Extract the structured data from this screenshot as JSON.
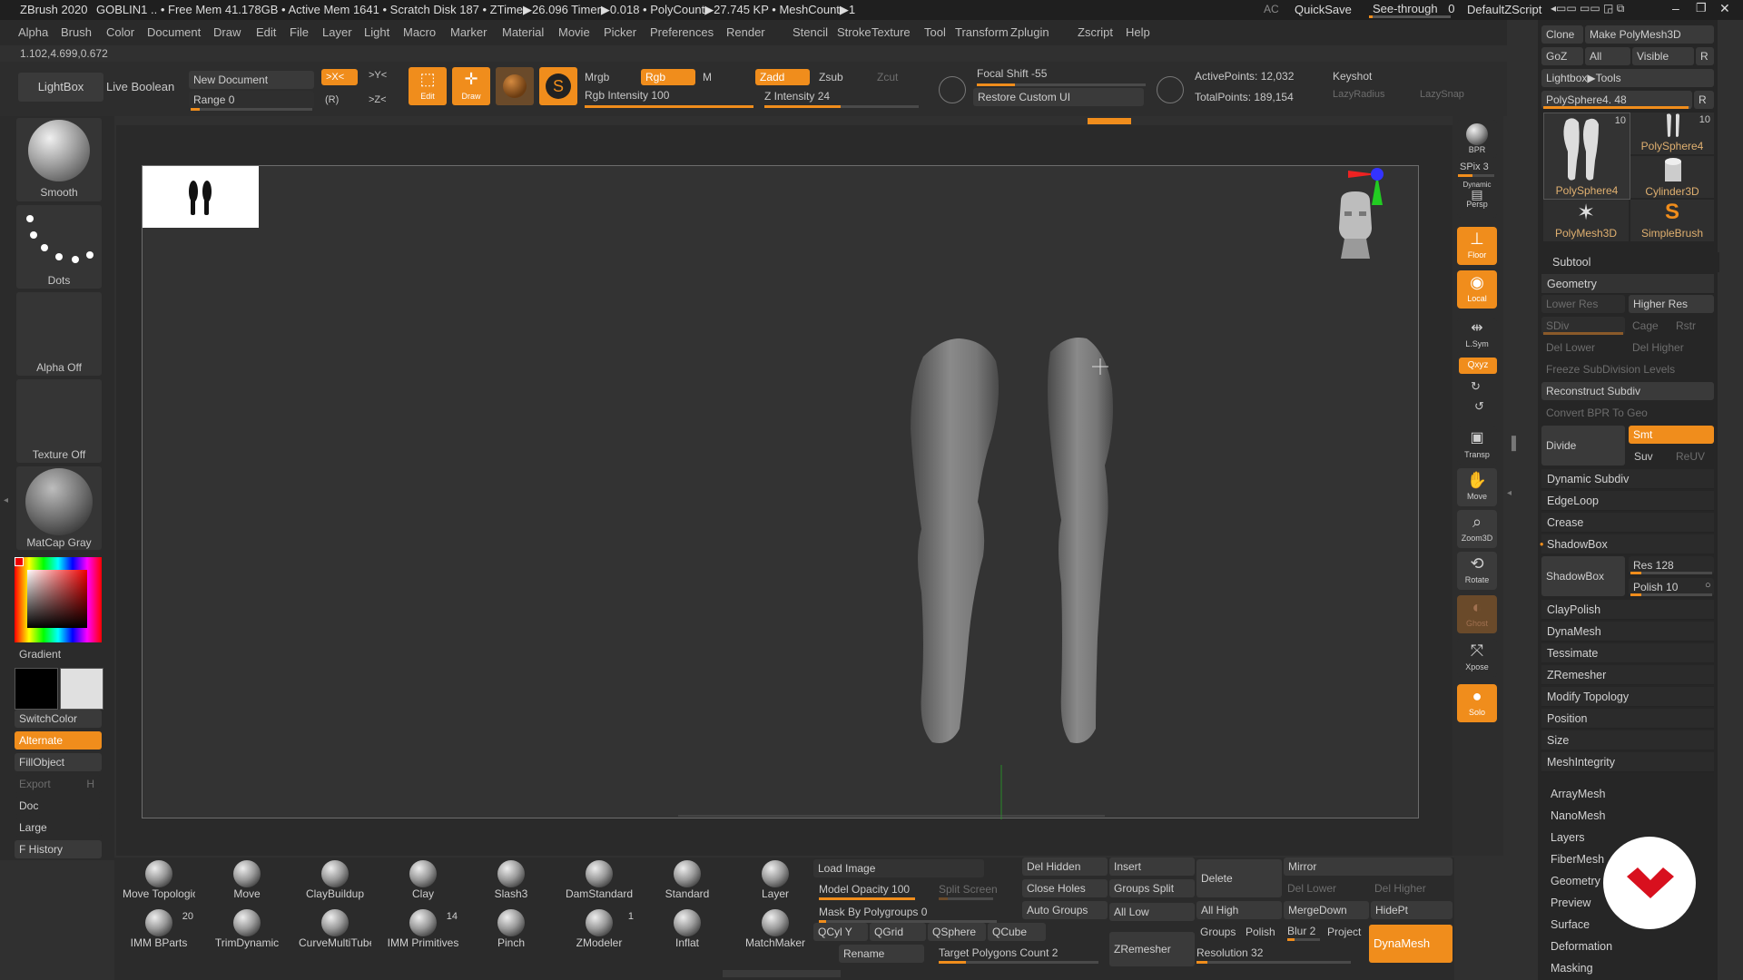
{
  "title_bar": {
    "app": "ZBrush 2020",
    "user": "GOBLIN1",
    "stats": ".. • Free Mem 41.178GB • Active Mem 1641 • Scratch Disk 187 • ZTime▶26.096 Timer▶0.018 • PolyCount▶27.745 KP • MeshCount▶1",
    "ac": "AC",
    "quicksave": "QuickSave",
    "see_through": "See-through",
    "see_through_value": "0",
    "script": "DefaultZScript"
  },
  "menu": [
    "Alpha",
    "Brush",
    "Color",
    "Document",
    "Draw",
    "Edit",
    "File",
    "Layer",
    "Light",
    "Macro",
    "Marker",
    "Material",
    "Movie",
    "Picker",
    "Preferences",
    "Render",
    "Stencil",
    "Stroke",
    "Texture",
    "Tool",
    "Transform",
    "Zplugin",
    "Zscript",
    "Help"
  ],
  "coords": "1.102,4.699,0.672",
  "top_shelf": {
    "lightbox": "LightBox",
    "live_boolean": "Live Boolean",
    "new_document": "New Document",
    "range": "Range 0",
    "sym_x": ">X<",
    "sym_y": ">Y<",
    "sym_z": ">Z<",
    "r": "(R)",
    "edit": "Edit",
    "draw": "Draw",
    "mrgb": "Mrgb",
    "rgb": "Rgb",
    "m": "M",
    "rgb_intensity": "Rgb Intensity 100",
    "zadd": "Zadd",
    "zsub": "Zsub",
    "zcut": "Zcut",
    "z_intensity": "Z Intensity 24",
    "focal_shift": "Focal Shift -55",
    "restore_ui": "Restore Custom UI",
    "active_points": "ActivePoints: 12,032",
    "total_points": "TotalPoints: 189,154",
    "keyshot": "Keyshot",
    "lazy_radius": "LazyRadius",
    "lazy_snap": "LazySnap"
  },
  "left_panel": {
    "smooth": "Smooth",
    "dots": "Dots",
    "alpha_off": "Alpha Off",
    "texture_off": "Texture Off",
    "matcap": "MatCap Gray",
    "gradient": "Gradient",
    "switch_color": "SwitchColor",
    "alternate": "Alternate",
    "fill_object": "FillObject",
    "export": "Export",
    "export_key": "H",
    "doc": "Doc",
    "large": "Large",
    "f_history": "F History"
  },
  "right_toolbar": {
    "bpr": "BPR",
    "spix": "SPix 3",
    "dynamic": "Dynamic",
    "persp": "Persp",
    "floor": "Floor",
    "local": "Local",
    "lsym": "L.Sym",
    "xyz": "Qxyz",
    "transp": "Transp",
    "move": "Move",
    "zoom3d": "Zoom3D",
    "rotate": "Rotate",
    "ghost": "Ghost",
    "xpose": "Xpose",
    "solo": "Solo"
  },
  "tool_panel": {
    "clone": "Clone",
    "make_polymesh": "Make PolyMesh3D",
    "goz": "GoZ",
    "all": "All",
    "visible": "Visible",
    "r": "R",
    "lightbox_tools": "Lightbox▶Tools",
    "polysphere_slider": "PolySphere4. 48",
    "thumbs": [
      {
        "label": "PolySphere4",
        "count": "10"
      },
      {
        "label": "PolySphere4",
        "count": "10"
      },
      {
        "label": "Cylinder3D",
        "count": ""
      },
      {
        "label": "PolyMesh3D",
        "count": ""
      },
      {
        "label": "SimpleBrush",
        "count": ""
      }
    ],
    "subtool": "Subtool",
    "geometry": "Geometry",
    "lower_res": "Lower Res",
    "higher_res": "Higher Res",
    "sdiv": "SDiv",
    "cage": "Cage",
    "rstr": "Rstr",
    "del_lower": "Del Lower",
    "del_higher": "Del Higher",
    "freeze": "Freeze SubDivision Levels",
    "reconstruct": "Reconstruct Subdiv",
    "convert_bpr": "Convert BPR To Geo",
    "divide": "Divide",
    "smt": "Smt",
    "suv": "Suv",
    "reuv": "ReUV",
    "sections": [
      "Dynamic Subdiv",
      "EdgeLoop",
      "Crease",
      "ShadowBox"
    ],
    "shadowbox": "ShadowBox",
    "res": "Res 128",
    "polish": "Polish 10",
    "more_sections": [
      "ClayPolish",
      "DynaMesh",
      "Tessimate",
      "ZRemesher",
      "Modify Topology",
      "Position",
      "Size",
      "MeshIntegrity"
    ],
    "outer_sections": [
      "ArrayMesh",
      "NanoMesh",
      "Layers",
      "FiberMesh",
      "Geometry HD",
      "Preview",
      "Surface",
      "Deformation",
      "Masking"
    ]
  },
  "bottom_brushes": [
    {
      "label": "Move Topologica",
      "count": ""
    },
    {
      "label": "Move",
      "count": ""
    },
    {
      "label": "ClayBuildup",
      "count": ""
    },
    {
      "label": "Clay",
      "count": ""
    },
    {
      "label": "Slash3",
      "count": ""
    },
    {
      "label": "DamStandard",
      "count": ""
    },
    {
      "label": "Standard",
      "count": ""
    },
    {
      "label": "Layer",
      "count": ""
    },
    {
      "label": "IMM BParts",
      "count": "20"
    },
    {
      "label": "TrimDynamic",
      "count": ""
    },
    {
      "label": "CurveMultiTube",
      "count": ""
    },
    {
      "label": "IMM Primitives",
      "count": "14"
    },
    {
      "label": "Pinch",
      "count": ""
    },
    {
      "label": "ZModeler",
      "count": "1"
    },
    {
      "label": "Inflat",
      "count": ""
    },
    {
      "label": "MatchMaker",
      "count": ""
    }
  ],
  "bottom_controls": {
    "load_image": "Load Image",
    "model_opacity": "Model Opacity 100",
    "split_screen": "Split Screen",
    "mask_by_poly": "Mask By Polygroups 0",
    "qcyl": "QCyl Y",
    "qgrid": "QGrid",
    "qsphere": "QSphere",
    "qcube": "QCube",
    "rename": "Rename",
    "target_poly": "Target Polygons Count 2",
    "del_hidden": "Del Hidden",
    "close_holes": "Close Holes",
    "auto_groups": "Auto Groups",
    "insert": "Insert",
    "groups_split": "Groups Split",
    "all_low": "All Low",
    "zremesher": "ZRemesher",
    "delete": "Delete",
    "all_high": "All High",
    "groups": "Groups",
    "polish": "Polish",
    "mirror": "Mirror",
    "del_lower": "Del Lower",
    "del_higher": "Del Higher",
    "merge_down": "MergeDown",
    "hidept": "HidePt",
    "blur": "Blur 2",
    "project": "Project",
    "resolution": "Resolution 32",
    "dynamesh": "DynaMesh"
  }
}
